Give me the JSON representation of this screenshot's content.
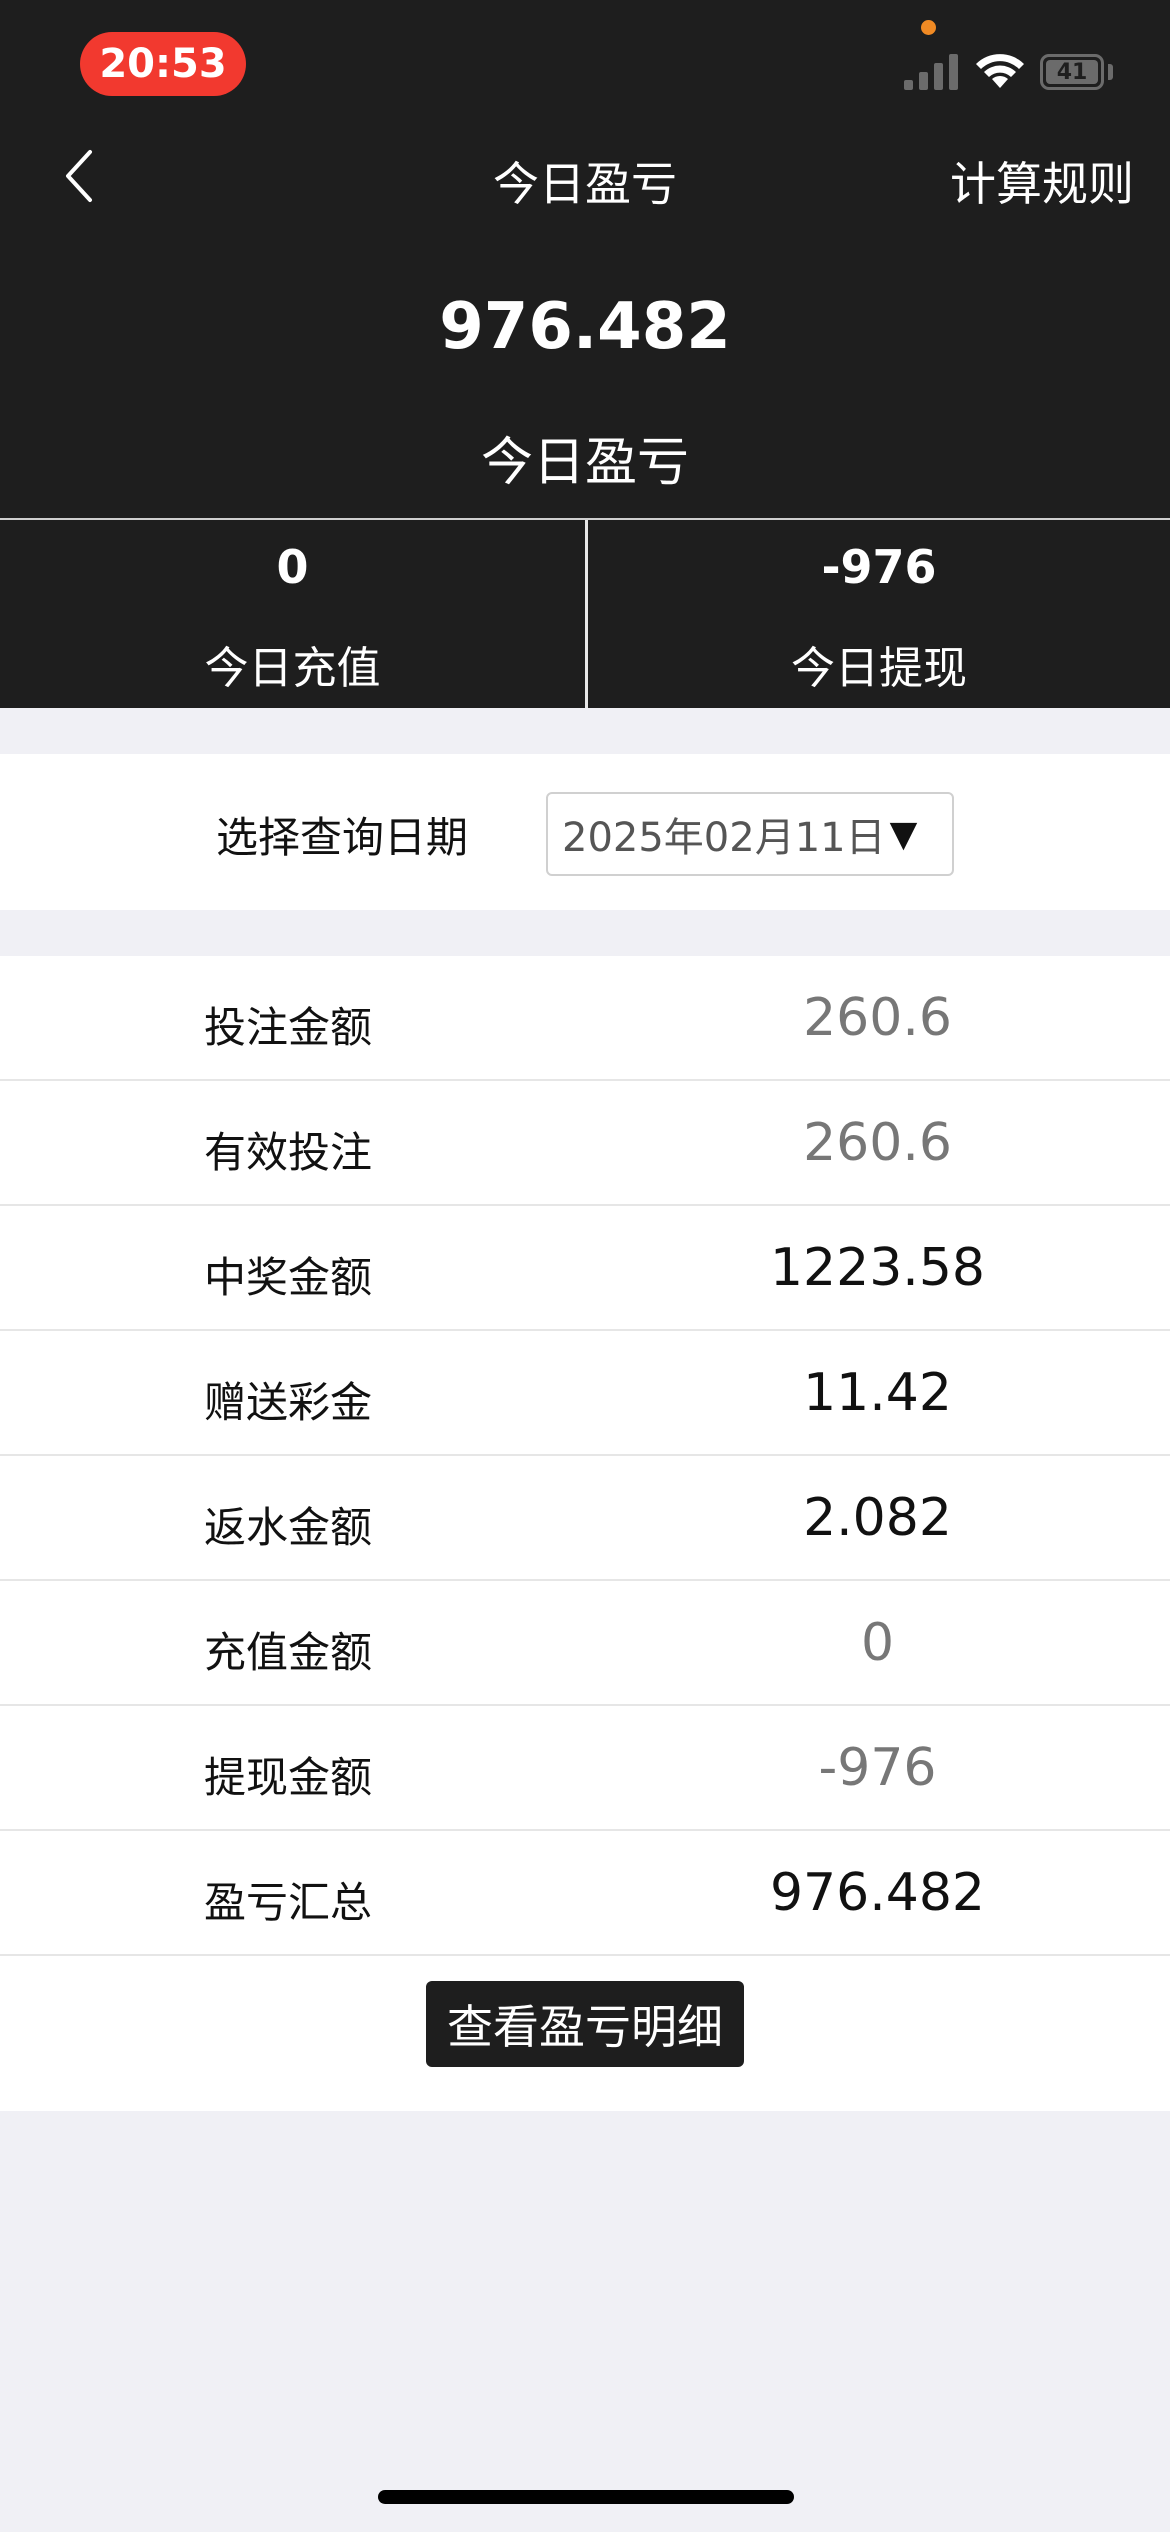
{
  "status_bar": {
    "time": "20:53",
    "battery": "41",
    "icons": [
      "signal-icon",
      "wifi-icon",
      "battery-icon"
    ]
  },
  "nav": {
    "title": "今日盈亏",
    "right_action": "计算规则",
    "back_icon": "chevron-left-icon"
  },
  "hero": {
    "value": "976.482",
    "label": "今日盈亏"
  },
  "stats": [
    {
      "value": "0",
      "label": "今日充值"
    },
    {
      "value": "-976",
      "label": "今日提现"
    }
  ],
  "date_filter": {
    "label": "选择查询日期",
    "value": "2025年02月11日",
    "arrow": "▼"
  },
  "rows": [
    {
      "label": "投注金额",
      "value": "260.6"
    },
    {
      "label": "有效投注",
      "value": "260.6"
    },
    {
      "label": "中奖金额",
      "value": "1223.58"
    },
    {
      "label": "赠送彩金",
      "value": "11.42"
    },
    {
      "label": "返水金额",
      "value": "2.082"
    },
    {
      "label": "充值金额",
      "value": "0"
    },
    {
      "label": "提现金额",
      "value": "-976"
    },
    {
      "label": "盈亏汇总",
      "value": "976.482"
    }
  ],
  "detail_button": "查看盈亏明细",
  "colors": {
    "header_bg": "#1e1e1e",
    "time_pill": "#f2392f",
    "page_bg": "#f0f0f5"
  }
}
